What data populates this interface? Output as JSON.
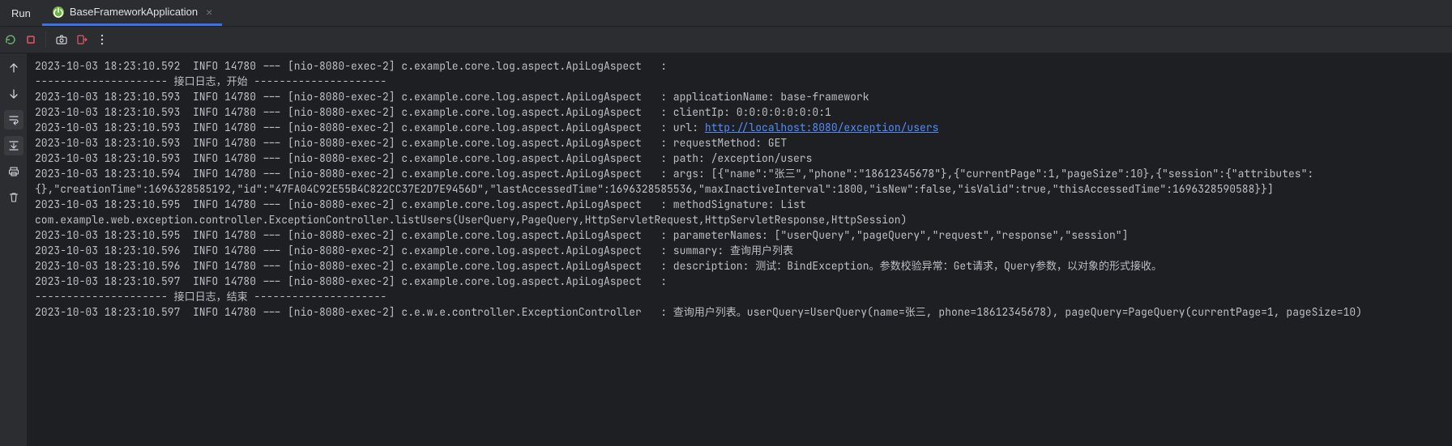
{
  "header": {
    "run_label": "Run",
    "tab_label": "BaseFrameworkApplication",
    "tab_close": "×"
  },
  "log": {
    "lines": [
      {
        "t": "plain",
        "text": "2023-10-03 18:23:10.592  INFO 14780 --- [nio-8080-exec-2] c.example.core.log.aspect.ApiLogAspect   : "
      },
      {
        "t": "plain",
        "text": "--------------------- 接口日志，开始 ---------------------"
      },
      {
        "t": "plain",
        "text": "2023-10-03 18:23:10.593  INFO 14780 --- [nio-8080-exec-2] c.example.core.log.aspect.ApiLogAspect   : applicationName: base-framework"
      },
      {
        "t": "plain",
        "text": "2023-10-03 18:23:10.593  INFO 14780 --- [nio-8080-exec-2] c.example.core.log.aspect.ApiLogAspect   : clientIp: 0:0:0:0:0:0:0:1"
      },
      {
        "t": "url",
        "prefix": "2023-10-03 18:23:10.593  INFO 14780 --- [nio-8080-exec-2] c.example.core.log.aspect.ApiLogAspect   : url: ",
        "url": "http://localhost:8080/exception/users"
      },
      {
        "t": "plain",
        "text": "2023-10-03 18:23:10.593  INFO 14780 --- [nio-8080-exec-2] c.example.core.log.aspect.ApiLogAspect   : requestMethod: GET"
      },
      {
        "t": "plain",
        "text": "2023-10-03 18:23:10.593  INFO 14780 --- [nio-8080-exec-2] c.example.core.log.aspect.ApiLogAspect   : path: /exception/users"
      },
      {
        "t": "plain",
        "text": "2023-10-03 18:23:10.594  INFO 14780 --- [nio-8080-exec-2] c.example.core.log.aspect.ApiLogAspect   : args: [{\"name\":\"张三\",\"phone\":\"18612345678\"},{\"currentPage\":1,\"pageSize\":10},{\"session\":{\"attributes\":{},\"creationTime\":1696328585192,\"id\":\"47FA04C92E55B4C822CC37E2D7E9456D\",\"lastAccessedTime\":1696328585536,\"maxInactiveInterval\":1800,\"isNew\":false,\"isValid\":true,\"thisAccessedTime\":1696328590588}}]"
      },
      {
        "t": "plain",
        "text": "2023-10-03 18:23:10.595  INFO 14780 --- [nio-8080-exec-2] c.example.core.log.aspect.ApiLogAspect   : methodSignature: List com.example.web.exception.controller.ExceptionController.listUsers(UserQuery,PageQuery,HttpServletRequest,HttpServletResponse,HttpSession)"
      },
      {
        "t": "plain",
        "text": "2023-10-03 18:23:10.595  INFO 14780 --- [nio-8080-exec-2] c.example.core.log.aspect.ApiLogAspect   : parameterNames: [\"userQuery\",\"pageQuery\",\"request\",\"response\",\"session\"]"
      },
      {
        "t": "plain",
        "text": "2023-10-03 18:23:10.596  INFO 14780 --- [nio-8080-exec-2] c.example.core.log.aspect.ApiLogAspect   : summary: 查询用户列表"
      },
      {
        "t": "plain",
        "text": "2023-10-03 18:23:10.596  INFO 14780 --- [nio-8080-exec-2] c.example.core.log.aspect.ApiLogAspect   : description: 测试：BindException。参数校验异常：Get请求，Query参数，以对象的形式接收。"
      },
      {
        "t": "plain",
        "text": "2023-10-03 18:23:10.597  INFO 14780 --- [nio-8080-exec-2] c.example.core.log.aspect.ApiLogAspect   : "
      },
      {
        "t": "plain",
        "text": "--------------------- 接口日志，结束 ---------------------"
      },
      {
        "t": "plain",
        "text": ""
      },
      {
        "t": "plain",
        "text": "2023-10-03 18:23:10.597  INFO 14780 --- [nio-8080-exec-2] c.e.w.e.controller.ExceptionController   : 查询用户列表。userQuery=UserQuery(name=张三, phone=18612345678), pageQuery=PageQuery(currentPage=1, pageSize=10)"
      }
    ]
  }
}
